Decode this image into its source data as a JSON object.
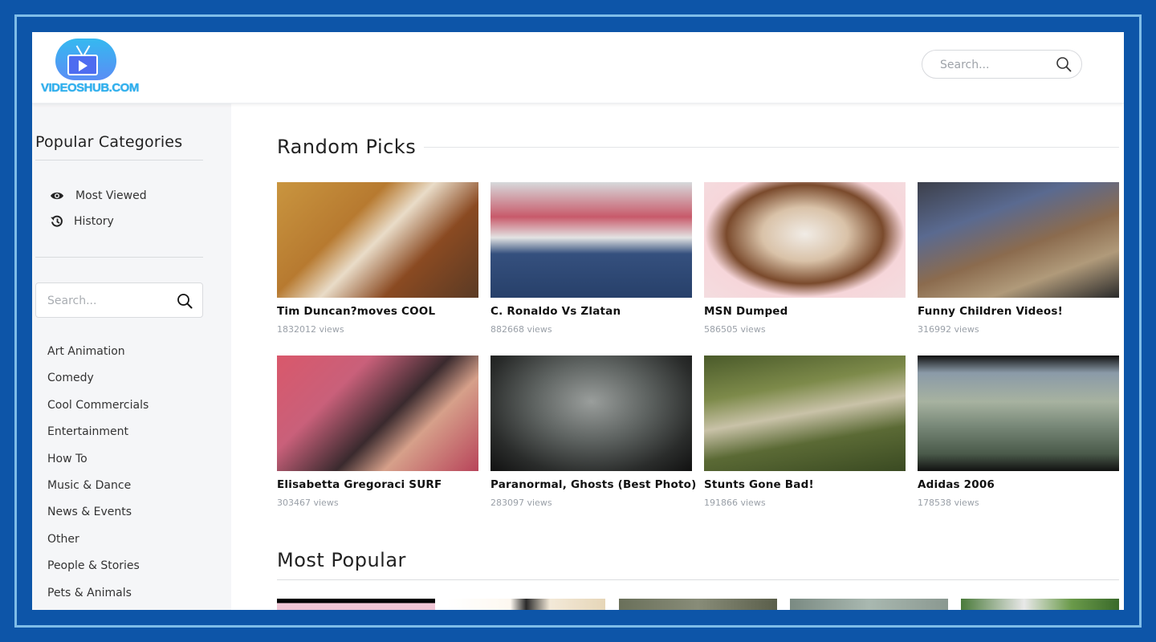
{
  "header": {
    "logo_text": "VIDEOSHUB.COM",
    "search_placeholder": "Search..."
  },
  "sidebar": {
    "title": "Popular Categories",
    "quick_links": [
      {
        "label": "Most Viewed",
        "icon": "eye-icon"
      },
      {
        "label": "History",
        "icon": "history-icon"
      }
    ],
    "search_placeholder": "Search...",
    "categories": [
      "Art Animation",
      "Comedy",
      "Cool Commercials",
      "Entertainment",
      "How To",
      "Music & Dance",
      "News & Events",
      "Other",
      "People & Stories",
      "Pets & Animals"
    ]
  },
  "main": {
    "random_picks": {
      "title": "Random Picks",
      "videos": [
        {
          "title": "Tim Duncan?moves COOL",
          "views": "1832012 views"
        },
        {
          "title": "C. Ronaldo Vs Zlatan",
          "views": "882668 views"
        },
        {
          "title": "MSN Dumped",
          "views": "586505 views"
        },
        {
          "title": "Funny Children Videos!",
          "views": "316992 views"
        },
        {
          "title": "Elisabetta Gregoraci SURF",
          "views": "303467 views"
        },
        {
          "title": "Paranormal, Ghosts (Best Photo)",
          "views": "283097 views"
        },
        {
          "title": "Stunts Gone Bad!",
          "views": "191866 views"
        },
        {
          "title": "Adidas 2006",
          "views": "178538 views"
        }
      ]
    },
    "most_popular": {
      "title": "Most Popular"
    }
  },
  "colors": {
    "frame_blue": "#0d55a8",
    "frame_line": "#7fbde8",
    "sidebar_bg": "#f5f6f8",
    "logo_blue": "#2fb1ee"
  }
}
